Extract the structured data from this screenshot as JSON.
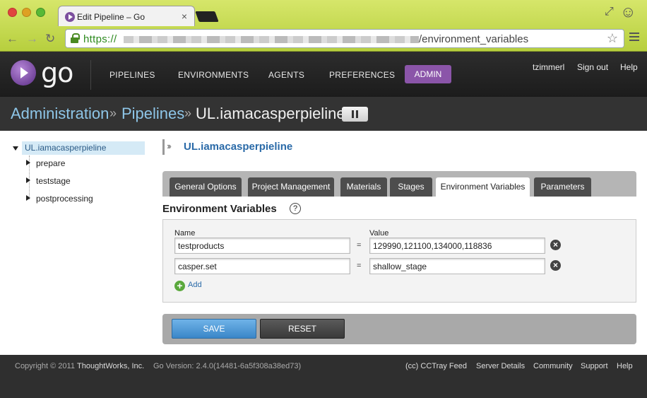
{
  "browser": {
    "tab_title": "Edit Pipeline – Go",
    "tab_close": "×",
    "url_scheme": "https://",
    "url_path": "/environment_variables"
  },
  "header": {
    "logo_text": "go",
    "nav": [
      "PIPELINES",
      "ENVIRONMENTS",
      "AGENTS",
      "PREFERENCES",
      "ADMIN"
    ],
    "user": "tzimmerl",
    "signout": "Sign out",
    "help": "Help"
  },
  "breadcrumb": {
    "admin": "Administration",
    "sep": "»",
    "pipelines": "Pipelines",
    "current": "UL.iamacasperpieline"
  },
  "tree": {
    "root": "UL.iamacasperpieline",
    "children": [
      "prepare",
      "teststage",
      "postprocessing"
    ]
  },
  "pipeline": {
    "arrows": "›››",
    "title": "UL.iamacasperpieline",
    "tabs": [
      "General Options",
      "Project Management",
      "Materials",
      "Stages",
      "Environment Variables",
      "Parameters"
    ],
    "active_tab": "Environment Variables"
  },
  "env": {
    "title": "Environment Variables",
    "help_glyph": "?",
    "name_label": "Name",
    "value_label": "Value",
    "eq": "=",
    "delete_glyph": "×",
    "add_glyph": "+",
    "rows": [
      {
        "name": "testproducts",
        "value": "129990,121100,134000,118836"
      },
      {
        "name": "casper.set",
        "value": "shallow_stage"
      }
    ],
    "add_label": "Add"
  },
  "actions": {
    "save": "SAVE",
    "reset": "RESET"
  },
  "footer": {
    "copyright": "Copyright © 2011",
    "company": "ThoughtWorks, Inc.",
    "version": "Go Version: 2.4.0(14481-6a5f308a38ed73)",
    "links": [
      "(cc) CCTray Feed",
      "Server Details",
      "Community",
      "Support",
      "Help"
    ]
  },
  "colors": {
    "accent": "#8b55a9",
    "link": "#2a6aa8",
    "breadcrumb": "#8ec6e8",
    "save": "#3a86c8"
  }
}
